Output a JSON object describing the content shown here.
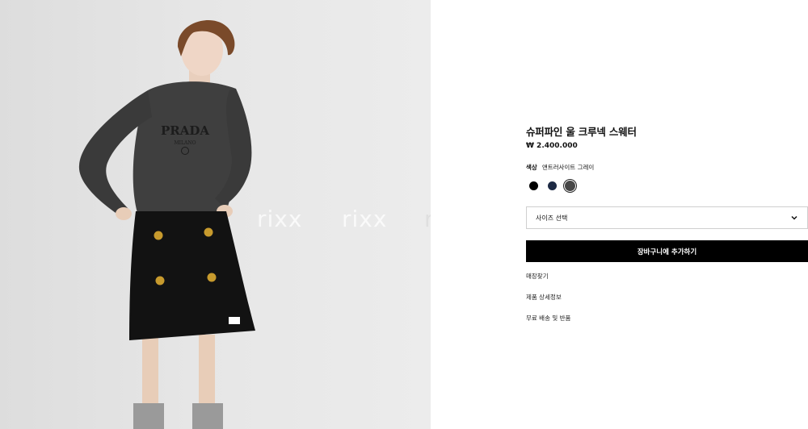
{
  "watermark": [
    "rixx",
    "rixx",
    "r"
  ],
  "product": {
    "title": "슈퍼파인 울 크루넥 스웨터",
    "price": "₩ 2.400.000",
    "color_label": "색상",
    "color_value": "앤트러사이트 그레이",
    "swatches": [
      {
        "name": "black",
        "color": "#000000"
      },
      {
        "name": "navy",
        "color": "#1d2a44"
      },
      {
        "name": "anthracite-grey",
        "color": "#474747",
        "selected": true
      }
    ],
    "size_select": "사이즈 선택",
    "add_to_cart": "장바구니에 추가하기",
    "links": [
      "매장찾기",
      "제품 상세정보",
      "무료 배송 및 반품"
    ]
  },
  "image": {
    "sweater_logo": "PRADA",
    "sweater_logo_sub": "MILANO"
  }
}
